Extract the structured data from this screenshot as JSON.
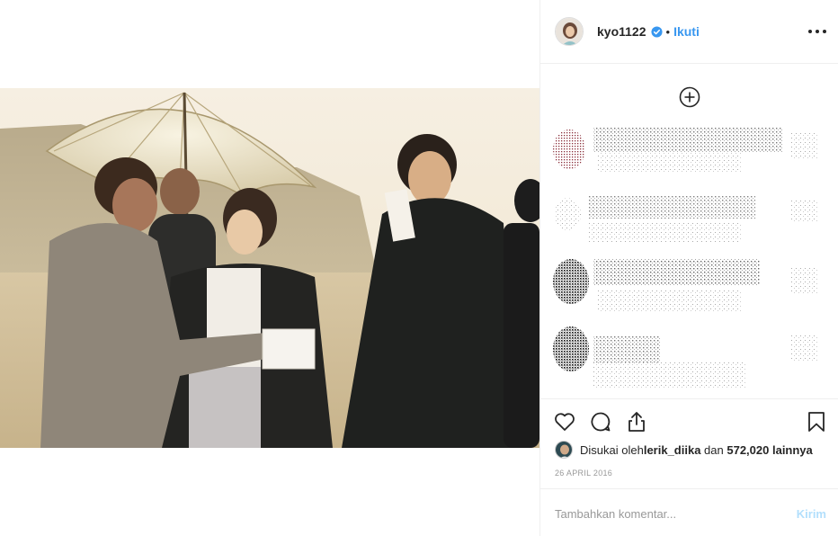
{
  "post": {
    "username": "kyo1122",
    "separator": "•",
    "follow_label": "Ikuti",
    "verified": true,
    "more_icon": "more-options-icon"
  },
  "likes": {
    "prefix": "Disukai oleh ",
    "liker": "lerik_diika",
    "middle": " dan ",
    "count": "572,020",
    "suffix": " lainnya"
  },
  "date": "26 APRIL 2016",
  "comment": {
    "placeholder": "Tambahkan komentar...",
    "post_label": "Kirim"
  },
  "icons": {
    "like": "heart-icon",
    "comment": "comment-bubble-icon",
    "share": "share-icon",
    "save": "bookmark-icon",
    "load_more": "plus-circle-icon"
  },
  "colors": {
    "link": "#3897f0",
    "post_disabled": "#b2dffc",
    "verified": "#3897f0",
    "muted": "#999999"
  }
}
